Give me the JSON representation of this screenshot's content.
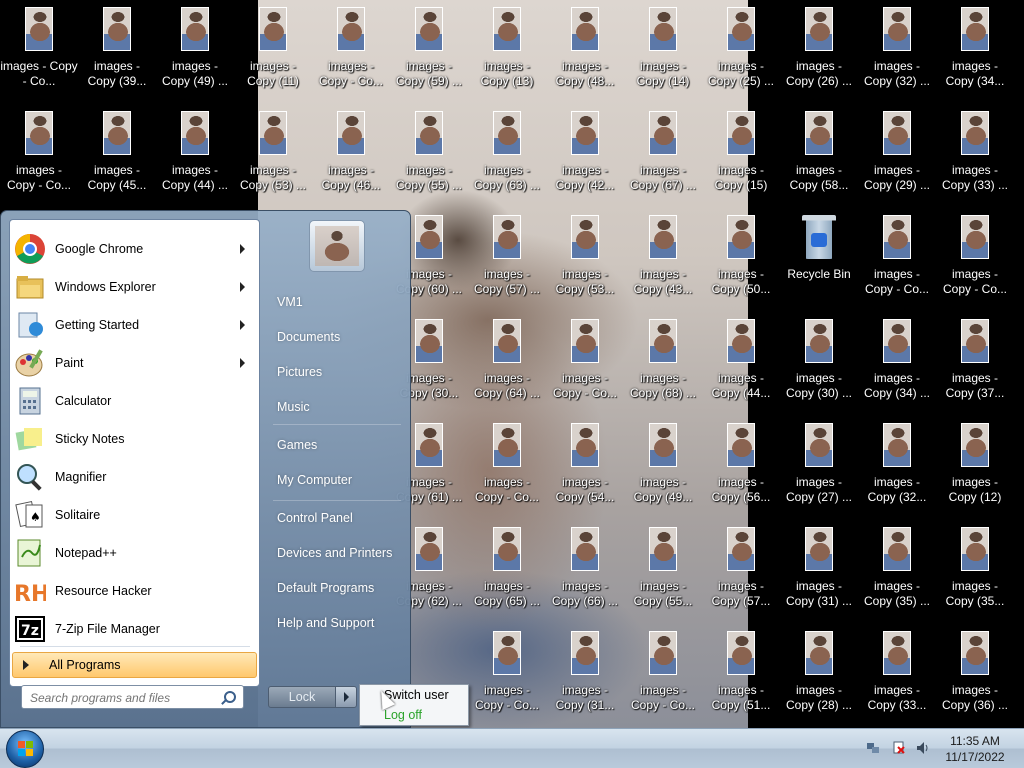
{
  "desktop": {
    "icons": [
      {
        "label": "images - Copy - Co...",
        "col": 0,
        "row": 0
      },
      {
        "label": "images -\nCopy (39...",
        "col": 1,
        "row": 0
      },
      {
        "label": "images -\nCopy (49) ...",
        "col": 2,
        "row": 0
      },
      {
        "label": "images -\nCopy (11)",
        "col": 3,
        "row": 0
      },
      {
        "label": "images -\nCopy - Co...",
        "col": 4,
        "row": 0
      },
      {
        "label": "images -\nCopy (59) ...",
        "col": 5,
        "row": 0
      },
      {
        "label": "images -\nCopy (13)",
        "col": 6,
        "row": 0
      },
      {
        "label": "images -\nCopy (48...",
        "col": 7,
        "row": 0
      },
      {
        "label": "images -\nCopy (14)",
        "col": 8,
        "row": 0
      },
      {
        "label": "images -\nCopy (25) ...",
        "col": 9,
        "row": 0
      },
      {
        "label": "images -\nCopy (26) ...",
        "col": 10,
        "row": 0
      },
      {
        "label": "images -\nCopy (32) ...",
        "col": 11,
        "row": 0
      },
      {
        "label": "images -\nCopy (34...",
        "col": 12,
        "row": 0
      },
      {
        "label": "images -\nCopy - Co...",
        "col": 0,
        "row": 1
      },
      {
        "label": "images -\nCopy (45...",
        "col": 1,
        "row": 1
      },
      {
        "label": "images -\nCopy (44) ...",
        "col": 2,
        "row": 1
      },
      {
        "label": "images -\nCopy (53) ...",
        "col": 3,
        "row": 1
      },
      {
        "label": "images -\nCopy (46...",
        "col": 4,
        "row": 1
      },
      {
        "label": "images -\nCopy (55) ...",
        "col": 5,
        "row": 1
      },
      {
        "label": "images -\nCopy (63) ...",
        "col": 6,
        "row": 1
      },
      {
        "label": "images -\nCopy (42...",
        "col": 7,
        "row": 1
      },
      {
        "label": "images -\nCopy (67) ...",
        "col": 8,
        "row": 1
      },
      {
        "label": "images -\nCopy (15)",
        "col": 9,
        "row": 1
      },
      {
        "label": "images -\nCopy (58...",
        "col": 10,
        "row": 1
      },
      {
        "label": "images -\nCopy (29) ...",
        "col": 11,
        "row": 1
      },
      {
        "label": "images -\nCopy (33) ...",
        "col": 12,
        "row": 1
      },
      {
        "label": "images -\nCopy (60) ...",
        "col": 5,
        "row": 2
      },
      {
        "label": "images -\nCopy (57) ...",
        "col": 6,
        "row": 2
      },
      {
        "label": "images -\nCopy (53...",
        "col": 7,
        "row": 2
      },
      {
        "label": "images -\nCopy (43...",
        "col": 8,
        "row": 2
      },
      {
        "label": "images -\nCopy (50...",
        "col": 9,
        "row": 2
      },
      {
        "label": "images -\nCopy - Co...",
        "col": 11,
        "row": 2
      },
      {
        "label": "images -\nCopy - Co...",
        "col": 12,
        "row": 2
      },
      {
        "label": "images -\nCopy (30...",
        "col": 5,
        "row": 3
      },
      {
        "label": "images -\nCopy (64) ...",
        "col": 6,
        "row": 3
      },
      {
        "label": "images -\nCopy - Co...",
        "col": 7,
        "row": 3
      },
      {
        "label": "images -\nCopy (68) ...",
        "col": 8,
        "row": 3
      },
      {
        "label": "images -\nCopy (44...",
        "col": 9,
        "row": 3
      },
      {
        "label": "images -\nCopy (30) ...",
        "col": 10,
        "row": 3
      },
      {
        "label": "images -\nCopy (34) ...",
        "col": 11,
        "row": 3
      },
      {
        "label": "images -\nCopy (37...",
        "col": 12,
        "row": 3
      },
      {
        "label": "images -\nCopy (61) ...",
        "col": 5,
        "row": 4
      },
      {
        "label": "images -\nCopy - Co...",
        "col": 6,
        "row": 4
      },
      {
        "label": "images -\nCopy (54...",
        "col": 7,
        "row": 4
      },
      {
        "label": "images -\nCopy (49...",
        "col": 8,
        "row": 4
      },
      {
        "label": "images -\nCopy (56...",
        "col": 9,
        "row": 4
      },
      {
        "label": "images -\nCopy (27) ...",
        "col": 10,
        "row": 4
      },
      {
        "label": "images -\nCopy (32...",
        "col": 11,
        "row": 4
      },
      {
        "label": "images -\nCopy (12)",
        "col": 12,
        "row": 4
      },
      {
        "label": "images -\nCopy (62) ...",
        "col": 5,
        "row": 5
      },
      {
        "label": "images -\nCopy (65) ...",
        "col": 6,
        "row": 5
      },
      {
        "label": "images -\nCopy (66) ...",
        "col": 7,
        "row": 5
      },
      {
        "label": "images -\nCopy (55...",
        "col": 8,
        "row": 5
      },
      {
        "label": "images -\nCopy (57...",
        "col": 9,
        "row": 5
      },
      {
        "label": "images -\nCopy (31) ...",
        "col": 10,
        "row": 5
      },
      {
        "label": "images -\nCopy (35) ...",
        "col": 11,
        "row": 5
      },
      {
        "label": "images -\nCopy (35...",
        "col": 12,
        "row": 5
      },
      {
        "label": "images -\nCopy - Co...",
        "col": 6,
        "row": 6
      },
      {
        "label": "images -\nCopy (31...",
        "col": 7,
        "row": 6
      },
      {
        "label": "images -\nCopy - Co...",
        "col": 8,
        "row": 6
      },
      {
        "label": "images -\nCopy (51...",
        "col": 9,
        "row": 6
      },
      {
        "label": "images -\nCopy (28) ...",
        "col": 10,
        "row": 6
      },
      {
        "label": "images -\nCopy (33...",
        "col": 11,
        "row": 6
      },
      {
        "label": "images -\nCopy (36) ...",
        "col": 12,
        "row": 6
      }
    ],
    "recycle_bin": {
      "label": "Recycle Bin",
      "col": 10,
      "row": 2
    }
  },
  "start_menu": {
    "programs": [
      {
        "label": "Google Chrome",
        "icon": "chrome-icon",
        "submenu": true
      },
      {
        "label": "Windows Explorer",
        "icon": "folder-icon",
        "submenu": true
      },
      {
        "label": "Getting Started",
        "icon": "getting-started-icon",
        "submenu": true
      },
      {
        "label": "Paint",
        "icon": "paint-icon",
        "submenu": true
      },
      {
        "label": "Calculator",
        "icon": "calculator-icon",
        "submenu": false
      },
      {
        "label": "Sticky Notes",
        "icon": "sticky-notes-icon",
        "submenu": false
      },
      {
        "label": "Magnifier",
        "icon": "magnifier-icon",
        "submenu": false
      },
      {
        "label": "Solitaire",
        "icon": "solitaire-icon",
        "submenu": false
      },
      {
        "label": "Notepad++",
        "icon": "notepadpp-icon",
        "submenu": false
      },
      {
        "label": "Resource Hacker",
        "icon": "resource-hacker-icon",
        "submenu": false
      },
      {
        "label": "7-Zip File Manager",
        "icon": "7zip-icon",
        "submenu": false
      }
    ],
    "all_programs": "All Programs",
    "search_placeholder": "Search programs and files",
    "right_links": [
      {
        "label": "VM1"
      },
      {
        "label": "Documents"
      },
      {
        "label": "Pictures"
      },
      {
        "label": "Music"
      },
      {
        "label": "Games"
      },
      {
        "label": "My Computer"
      },
      {
        "label": "Control Panel"
      },
      {
        "label": "Devices and Printers"
      },
      {
        "label": "Default Programs"
      },
      {
        "label": "Help and Support"
      }
    ],
    "lock_label": "Lock",
    "power_menu": [
      {
        "label": "Switch user",
        "enabled": true
      },
      {
        "label": "Log off",
        "enabled": false
      }
    ]
  },
  "taskbar": {
    "time": "11:35 AM",
    "date": "11/17/2022",
    "tray_icons": [
      "network-icon",
      "action-center-icon",
      "volume-icon"
    ]
  }
}
